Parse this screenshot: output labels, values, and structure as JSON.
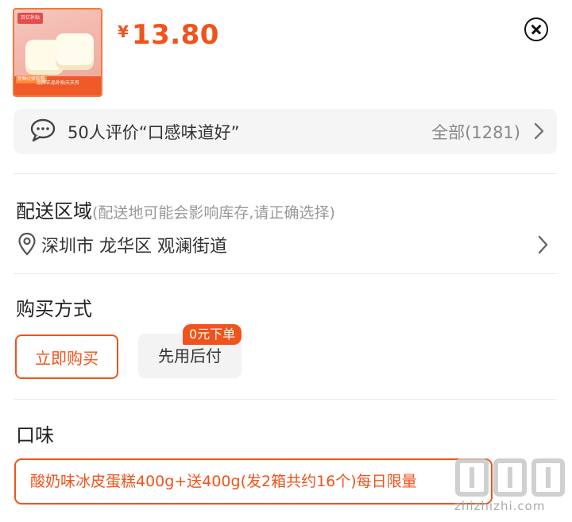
{
  "product": {
    "thumb_brand": "百亿补贴",
    "thumb_band_label": "新鲜Q弹软糯",
    "thumb_band_text": "品牌正品补贴天天有",
    "currency": "¥",
    "price": "13.80"
  },
  "review": {
    "text": "50人评价“口感味道好”",
    "all_label": "全部(1281)"
  },
  "delivery": {
    "title": "配送区域",
    "hint": "(配送地可能会影响库存,请正确选择)",
    "address": "深圳市 龙华区 观澜街道"
  },
  "purchase": {
    "title": "购买方式",
    "options": [
      {
        "label": "立即购买",
        "selected": true
      },
      {
        "label": "先用后付",
        "selected": false,
        "tag": "0元下单"
      }
    ]
  },
  "flavor": {
    "title": "口味",
    "options": [
      {
        "label": "酸奶味冰皮蛋糕400g+送400g(发2箱共约16个)每日限量",
        "selected": true
      }
    ]
  },
  "watermark": {
    "url": "zhizhizhi.com"
  },
  "colors": {
    "accent": "#f0531c",
    "panel": "#f5f5f5"
  }
}
